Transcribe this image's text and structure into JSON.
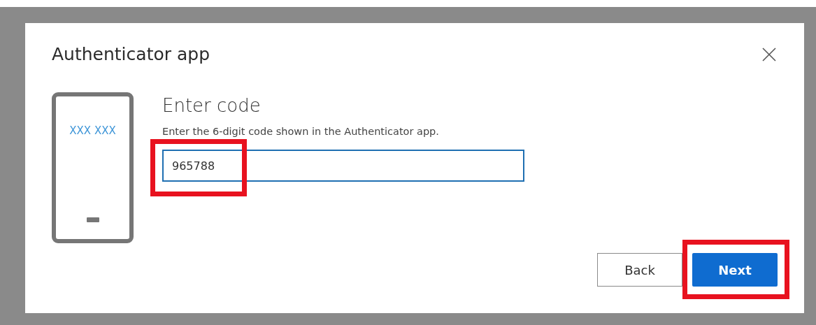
{
  "dialog": {
    "title": "Authenticator app",
    "phone_code": "XXX XXX",
    "heading": "Enter code",
    "description": "Enter the 6-digit code shown in the Authenticator app.",
    "code_field": {
      "value": "965788",
      "highlighted": true
    },
    "buttons": [
      {
        "label": "Back",
        "kind": "secondary"
      },
      {
        "label": "Next",
        "kind": "primary",
        "highlighted": true
      }
    ]
  }
}
